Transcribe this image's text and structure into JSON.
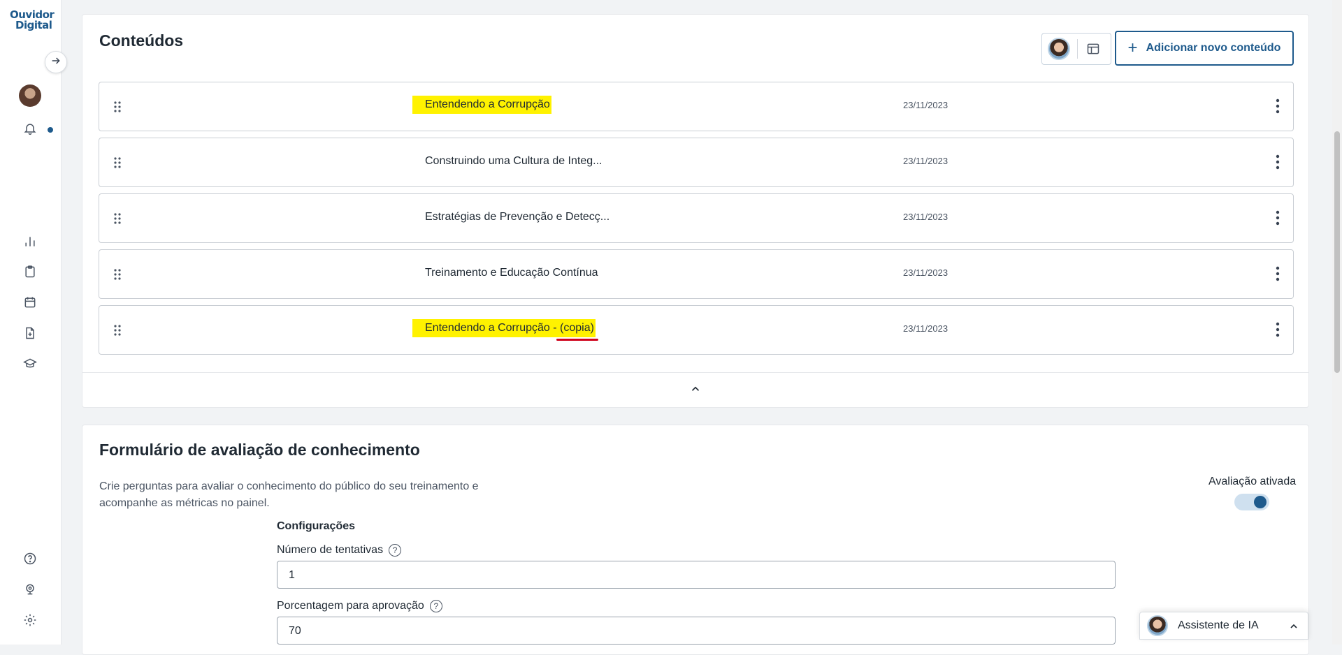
{
  "app": {
    "logo_line1": "Ouvidor",
    "logo_line2": "Digital"
  },
  "colors": {
    "brand": "#1e5a8c",
    "highlight": "#fff200",
    "annotation_underline": "#d0021b"
  },
  "sidebar": {
    "icons": [
      "arrow-right-icon",
      "avatar",
      "bell-icon",
      "bar-chart-icon",
      "clipboard-icon",
      "calendar-icon",
      "file-add-icon",
      "graduation-cap-icon",
      "help-circle-icon",
      "webcam-icon",
      "gear-icon"
    ]
  },
  "contents": {
    "title": "Conteúdos",
    "add_button": "Adicionar novo conteúdo",
    "rows": [
      {
        "title": "Entendendo a Corrupção",
        "date": "23/11/2023"
      },
      {
        "title": "Construindo uma Cultura de Integ...",
        "date": "23/11/2023"
      },
      {
        "title": "Estratégias de Prevenção e Detecç...",
        "date": "23/11/2023"
      },
      {
        "title": "Treinamento e Educação Contínua",
        "date": "23/11/2023"
      },
      {
        "title": "Entendendo a Corrupção - (copia)",
        "date": "23/11/2023"
      }
    ]
  },
  "evaluation": {
    "title": "Formulário de avaliação de conhecimento",
    "description": "Crie perguntas para avaliar o conhecimento do público do seu treinamento e acompanhe as métricas no painel.",
    "toggle_label": "Avaliação ativada",
    "toggle_on": true,
    "config_title": "Configurações",
    "attempts_label": "Número de tentativas",
    "attempts_value": "1",
    "approval_label": "Porcentagem para aprovação",
    "approval_value": "70",
    "help_glyph": "?"
  },
  "ai_assistant": {
    "label": "Assistente de IA"
  }
}
